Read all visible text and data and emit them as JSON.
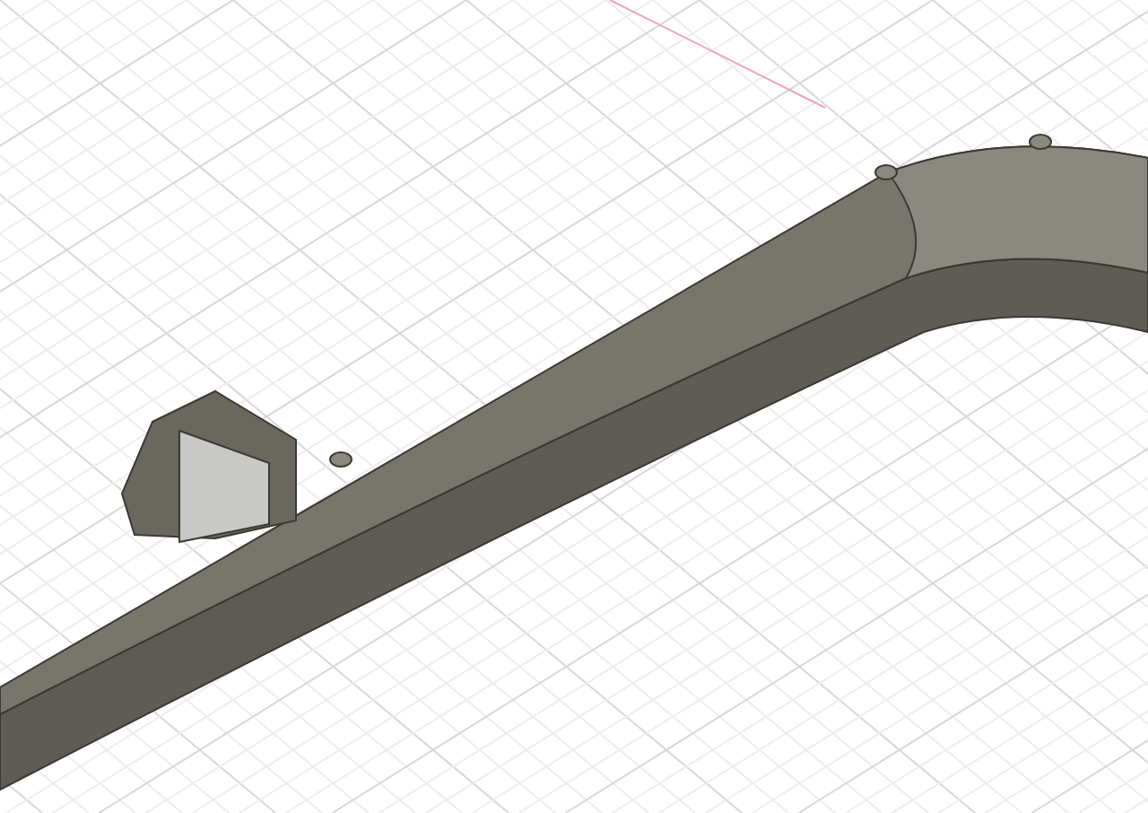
{
  "viewport": {
    "grid": true
  }
}
